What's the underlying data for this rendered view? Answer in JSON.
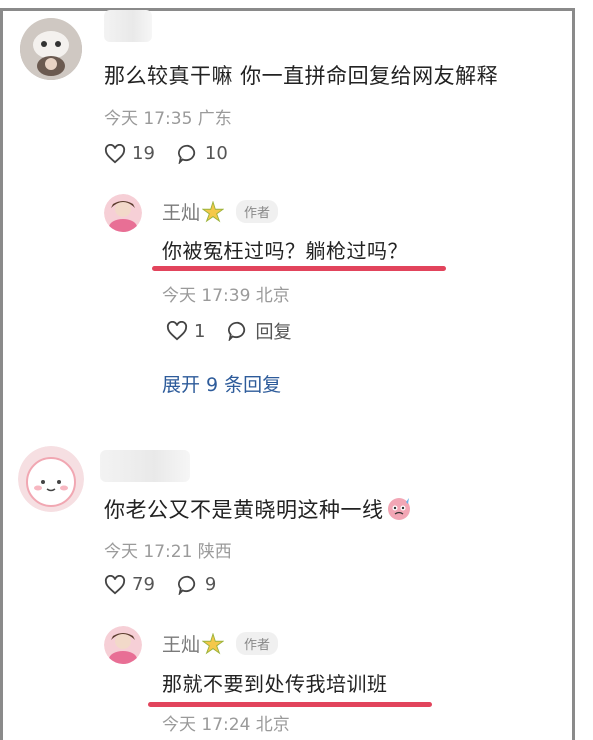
{
  "comments": [
    {
      "text": "那么较真干嘛 你一直拼命回复给网友解释",
      "meta": "今天 17:35 广东",
      "likes": "19",
      "replies_count": "10",
      "reply": {
        "username": "王灿",
        "badge": "作者",
        "text": "你被冤枉过吗？躺枪过吗？",
        "meta": "今天 17:39 北京",
        "likes": "1",
        "reply_label": "回复"
      },
      "expand_label": "展开 9 条回复"
    },
    {
      "text": "你老公又不是黄晓明这种一线",
      "meta": "今天 17:21 陕西",
      "likes": "79",
      "replies_count": "9",
      "reply": {
        "username": "王灿",
        "badge": "作者",
        "text": "那就不要到处传我培训班",
        "meta": "今天 17:24 北京"
      }
    }
  ],
  "colors": {
    "highlight_underline": "#e2445c",
    "link_blue": "#2d5b9a",
    "meta_gray": "#9a9a9a"
  }
}
